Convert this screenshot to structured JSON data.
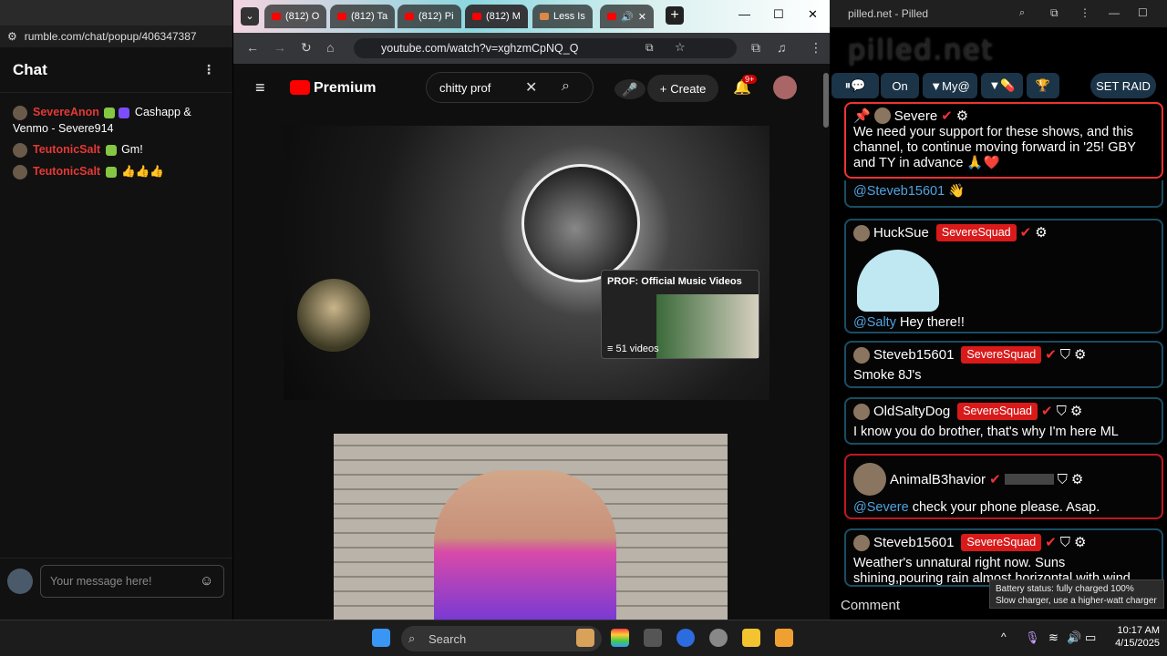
{
  "rumble": {
    "url": "rumble.com/chat/popup/406347387",
    "chat_title": "Chat",
    "messages": [
      {
        "user": "SevereAnon",
        "text": "Cashapp & Venmo - Severe914"
      },
      {
        "user": "TeutonicSalt",
        "text": "Gm!"
      },
      {
        "user": "TeutonicSalt",
        "text": "👍👍👍"
      }
    ],
    "input_placeholder": "Your message here!"
  },
  "browser": {
    "tabs": [
      "(812) O",
      "(812) Ta",
      "(812) Pi",
      "(812) M",
      "Less Is"
    ],
    "url": "youtube.com/watch?v=xghzmCpNQ_Q"
  },
  "youtube": {
    "logo": "Premium",
    "search_value": "chitty prof",
    "create_label": "Create",
    "notif_count": "9+",
    "playlist_title": "PROF: Official Music Videos",
    "playlist_count": "51 videos"
  },
  "pilled": {
    "window_title": "pilled.net - Pilled",
    "logo": "pilled.net",
    "toolbar": {
      "on": "On",
      "my": "My@",
      "raid": "SET RAID"
    },
    "pinned": {
      "user": "Severe",
      "text": "We need your support for these shows, and this channel, to continue moving forward in '25! GBY and TY in advance 🙏❤️"
    },
    "partial": {
      "mention": "@Steveb15601",
      "text": "👋"
    },
    "messages": [
      {
        "user": "HuckSue",
        "badge": "SevereSquad",
        "mention": "@Salty",
        "text": "Hey there!!"
      },
      {
        "user": "Steveb15601",
        "badge": "SevereSquad",
        "mention": "",
        "text": "Smoke 8J's"
      },
      {
        "user": "OldSaltyDog",
        "badge": "SevereSquad",
        "mention": "",
        "text": "I know you do brother, that's why I'm here ML"
      },
      {
        "user": "AnimalB3havior",
        "badge": "",
        "mention": "@Severe",
        "text": "check your phone please. Asap."
      },
      {
        "user": "Steveb15601",
        "badge": "SevereSquad",
        "mention": "",
        "text": "Weather's unnatural right now. Suns shining,pouring rain almost horizontal with wind"
      }
    ],
    "comment_label": "Comment",
    "tooltip": [
      "Battery status: fully charged 100%",
      "Slow charger, use a higher-watt charger"
    ]
  },
  "taskbar": {
    "search": "Search",
    "time": "10:17 AM",
    "date": "4/15/2025"
  }
}
